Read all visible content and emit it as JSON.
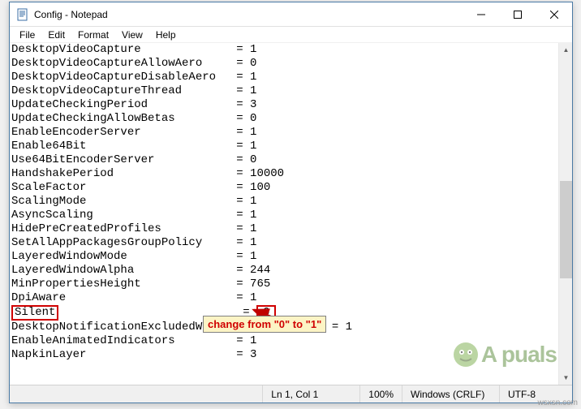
{
  "window": {
    "title": "Config - Notepad"
  },
  "menu": {
    "file": "File",
    "edit": "Edit",
    "format": "Format",
    "view": "View",
    "help": "Help"
  },
  "config_lines": [
    {
      "key": "DesktopVideoCapture",
      "value": "1"
    },
    {
      "key": "DesktopVideoCaptureAllowAero",
      "value": "0"
    },
    {
      "key": "DesktopVideoCaptureDisableAero",
      "value": "1"
    },
    {
      "key": "DesktopVideoCaptureThread",
      "value": "1"
    },
    {
      "key": "UpdateCheckingPeriod",
      "value": "3"
    },
    {
      "key": "UpdateCheckingAllowBetas",
      "value": "0"
    },
    {
      "key": "EnableEncoderServer",
      "value": "1"
    },
    {
      "key": "Enable64Bit",
      "value": "1"
    },
    {
      "key": "Use64BitEncoderServer",
      "value": "0"
    },
    {
      "key": "HandshakePeriod",
      "value": "10000"
    },
    {
      "key": "ScaleFactor",
      "value": "100"
    },
    {
      "key": "ScalingMode",
      "value": "1"
    },
    {
      "key": "AsyncScaling",
      "value": "1"
    },
    {
      "key": "HidePreCreatedProfiles",
      "value": "1"
    },
    {
      "key": "SetAllAppPackagesGroupPolicy",
      "value": "1"
    },
    {
      "key": "LayeredWindowMode",
      "value": "1"
    },
    {
      "key": "LayeredWindowAlpha",
      "value": "244"
    },
    {
      "key": "MinPropertiesHeight",
      "value": "765"
    },
    {
      "key": "DpiAware",
      "value": "1"
    },
    {
      "key": "Silent",
      "value": "0",
      "highlight": true
    },
    {
      "key": "DesktopNotificationExcludedWindowClassNamesCSV",
      "value": "1"
    },
    {
      "key": "EnableAnimatedIndicators",
      "value": "1"
    },
    {
      "key": "NapkinLayer",
      "value": "3"
    }
  ],
  "status": {
    "position": "Ln 1, Col 1",
    "zoom": "100%",
    "line_ending": "Windows (CRLF)",
    "encoding": "UTF-8"
  },
  "annotation": {
    "text": "change from \"0\" to \"1\""
  },
  "watermark": {
    "text": "A puals",
    "corner": "wsxsn.com"
  }
}
